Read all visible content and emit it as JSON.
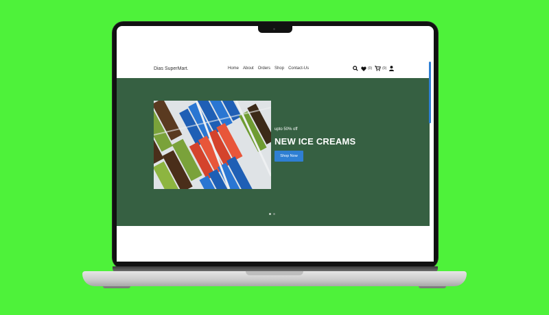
{
  "site": {
    "brand": "Dias SuperMart.",
    "nav": [
      "Home",
      "About",
      "Orders",
      "Shop",
      "Contact-Us"
    ],
    "wishlist_count": "(0)",
    "cart_count": "(0)"
  },
  "hero": {
    "subtitle": "upto 50% off",
    "title": "NEW ICE CREAMS",
    "button_label": "Shop Now"
  },
  "icons": [
    "search-icon",
    "heart-icon",
    "cart-icon",
    "user-icon"
  ],
  "colors": {
    "background": "#4ef23a",
    "hero": "#366042",
    "accent": "#2f7fd3"
  }
}
